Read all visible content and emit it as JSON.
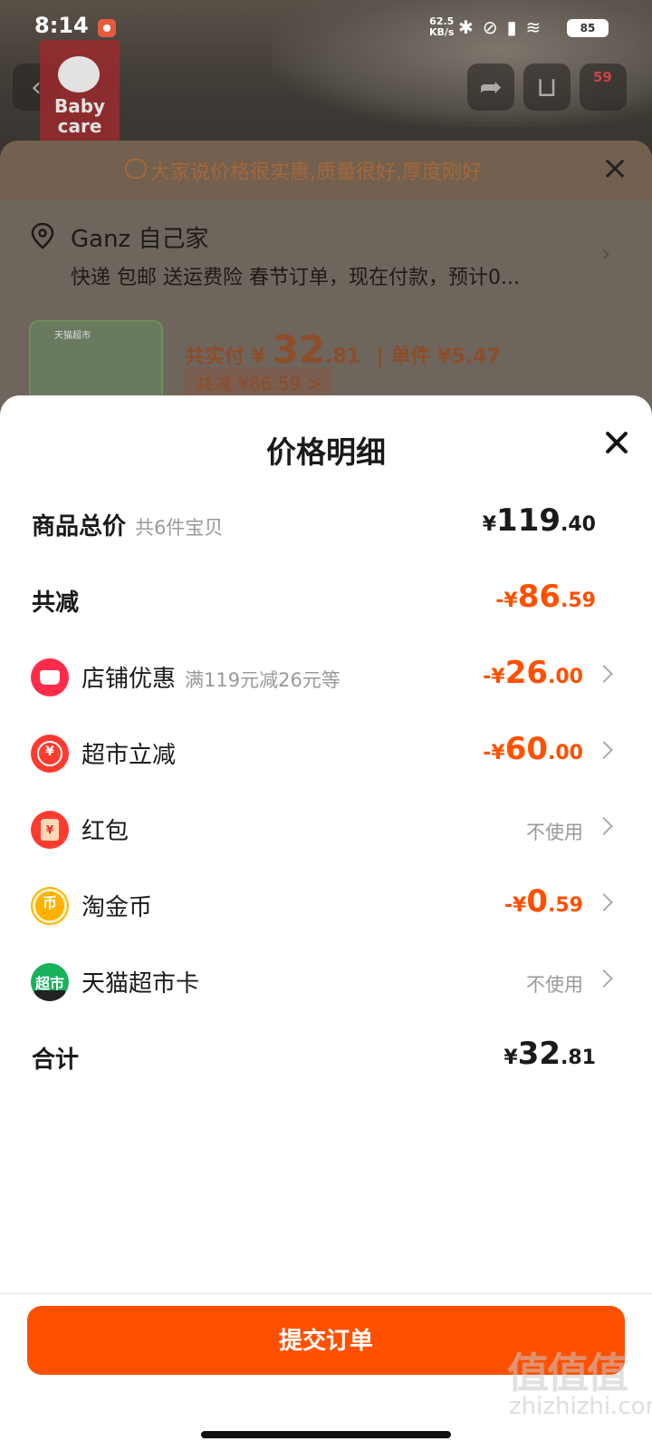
{
  "status_bar": {
    "time": "8:14",
    "speed_value": "62.5",
    "speed_unit": "KB/s",
    "battery": "85"
  },
  "background": {
    "brand_logo_text": "Baby care",
    "cart_badge": "59"
  },
  "order_sheet": {
    "banner_text": "大家说价格很实惠,质量很好,厚度刚好",
    "address_name": "Ganz 自己家",
    "address_detail": "快递 包邮 送运费险 春节订单，现在付款，预计0...",
    "thumb_tag": "天猫超市",
    "price_prefix": "共实付 ¥",
    "price_int": "32",
    "price_dec": ".81",
    "unit_price": "| 单件 ¥5.47",
    "saved": "共减 ¥86.59 >"
  },
  "modal": {
    "title": "价格明细",
    "rows": [
      {
        "label": "商品总价",
        "sub": "共6件宝贝",
        "sym": "¥",
        "int": "119",
        "dec": ".40"
      },
      {
        "label": "共减",
        "sym": "-¥",
        "int": "86",
        "dec": ".59"
      },
      {
        "label": "店铺优惠",
        "sub": "满119元减26元等",
        "icon": "shop-icon",
        "sym": "-¥",
        "int": "26",
        "dec": ".00"
      },
      {
        "label": "超市立减",
        "icon": "yuan-coupon-icon",
        "sym": "-¥",
        "int": "60",
        "dec": ".00"
      },
      {
        "label": "红包",
        "icon": "red-packet-icon",
        "status": "不使用"
      },
      {
        "label": "淘金币",
        "icon": "gold-coin-icon",
        "sym": "-¥",
        "int": "0",
        "dec": ".59"
      },
      {
        "label": "天猫超市卡",
        "icon": "supermarket-card-icon",
        "icon_text": "超市",
        "status": "不使用"
      },
      {
        "label": "合计",
        "sym": "¥",
        "int": "32",
        "dec": ".81"
      }
    ],
    "submit_label": "提交订单"
  },
  "colors": {
    "accent": "#ff5000",
    "text": "#1a1a1a",
    "muted": "#999999"
  },
  "watermark": {
    "main": "值值值",
    "sub": "zhizhizhi.com"
  }
}
